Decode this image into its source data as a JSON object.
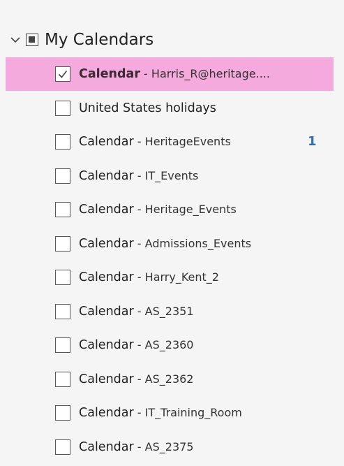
{
  "group": {
    "title": "My Calendars",
    "expanded": true,
    "icons": {
      "toggle": "chevron-down-icon",
      "checkbox": "partial-checkbox-icon"
    }
  },
  "colors": {
    "background": "#f5f5f5",
    "selected_highlight": "#f4aadc",
    "badge": "#2f6fb7"
  },
  "calendars": [
    {
      "name": "Calendar",
      "separator": " - ",
      "account": "Harris_R@heritage....",
      "checked": true,
      "selected": true,
      "badge": ""
    },
    {
      "name": "United States holidays",
      "separator": "",
      "account": "",
      "checked": false,
      "selected": false,
      "badge": ""
    },
    {
      "name": "Calendar",
      "separator": " - ",
      "account": "HeritageEvents",
      "checked": false,
      "selected": false,
      "badge": "1"
    },
    {
      "name": "Calendar",
      "separator": " - ",
      "account": "IT_Events",
      "checked": false,
      "selected": false,
      "badge": ""
    },
    {
      "name": "Calendar",
      "separator": " - ",
      "account": "Heritage_Events",
      "checked": false,
      "selected": false,
      "badge": ""
    },
    {
      "name": "Calendar",
      "separator": " - ",
      "account": "Admissions_Events",
      "checked": false,
      "selected": false,
      "badge": ""
    },
    {
      "name": "Calendar",
      "separator": " - ",
      "account": "Harry_Kent_2",
      "checked": false,
      "selected": false,
      "badge": ""
    },
    {
      "name": "Calendar",
      "separator": " - ",
      "account": "AS_2351",
      "checked": false,
      "selected": false,
      "badge": ""
    },
    {
      "name": "Calendar",
      "separator": " - ",
      "account": "AS_2360",
      "checked": false,
      "selected": false,
      "badge": ""
    },
    {
      "name": "Calendar",
      "separator": " - ",
      "account": "AS_2362",
      "checked": false,
      "selected": false,
      "badge": ""
    },
    {
      "name": "Calendar",
      "separator": " - ",
      "account": "IT_Training_Room",
      "checked": false,
      "selected": false,
      "badge": ""
    },
    {
      "name": "Calendar",
      "separator": " - ",
      "account": "AS_2375",
      "checked": false,
      "selected": false,
      "badge": ""
    }
  ]
}
